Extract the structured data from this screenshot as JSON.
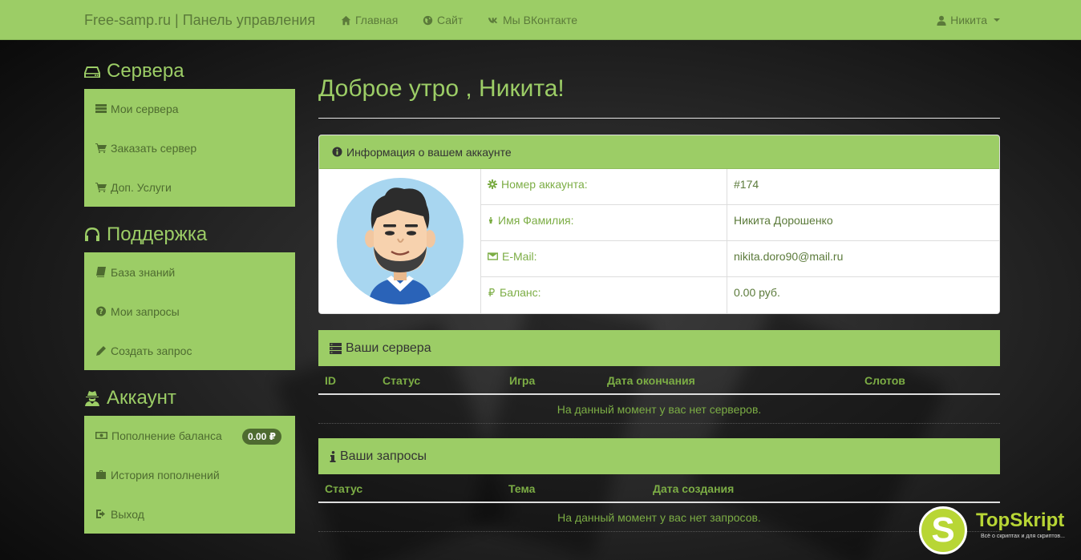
{
  "navbar": {
    "brand": "Free-samp.ru | Панель управления",
    "links": [
      {
        "label": "Главная",
        "icon": "home-icon"
      },
      {
        "label": "Сайт",
        "icon": "globe-icon"
      },
      {
        "label": "Мы ВКонтакте",
        "icon": "vk-icon"
      }
    ],
    "user": "Никита"
  },
  "sidebar": {
    "servers": {
      "title": "Сервера",
      "items": [
        "Мои сервера",
        "Заказать сервер",
        "Доп. Услуги"
      ]
    },
    "support": {
      "title": "Поддержка",
      "items": [
        "База знаний",
        "Мои запросы",
        "Создать запрос"
      ]
    },
    "account": {
      "title": "Аккаунт",
      "items": [
        "Пополнение баланса",
        "История пополнений",
        "Выход"
      ],
      "balance_badge": "0.00 ₽"
    }
  },
  "main": {
    "greeting": "Доброе утро , Никита!",
    "account_panel": {
      "title": "Информация о вашем аккаунте",
      "rows": [
        {
          "label": "Номер аккаунта:",
          "value": "#174"
        },
        {
          "label": "Имя Фамилия:",
          "value": "Никита Дорошенко"
        },
        {
          "label": "E-Mail:",
          "value": "nikita.doro90@mail.ru"
        },
        {
          "label": "Баланс:",
          "value": "0.00 руб."
        }
      ]
    },
    "servers_section": {
      "title": "Ваши сервера",
      "columns": [
        "ID",
        "Статус",
        "Игра",
        "Дата окончания",
        "Слотов"
      ],
      "empty": "На данный момент у вас нет серверов."
    },
    "requests_section": {
      "title": "Ваши запросы",
      "columns": [
        "Статус",
        "Тема",
        "Дата создания"
      ],
      "empty": "На данный момент у вас нет запросов."
    }
  },
  "watermark": {
    "letter": "S",
    "title": "TopSkript",
    "subtitle": "Всё о скриптах и для скриптов..."
  },
  "colors": {
    "accent": "#9ccd66",
    "accent_text": "#7cad45",
    "dark_green": "#4e6b30",
    "watermark": "#b8d635"
  }
}
